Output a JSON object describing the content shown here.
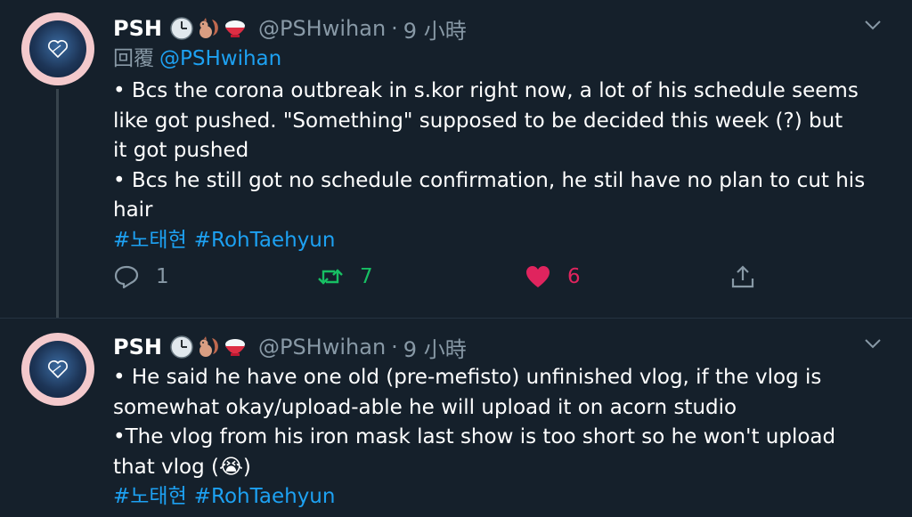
{
  "tweets": [
    {
      "name": "PSH",
      "emojis": [
        "clock-emoji",
        "squirrel-emoji",
        "rice-emoji"
      ],
      "handle": "@PSHwihan",
      "separator": "·",
      "time": "9 小時",
      "reply_prefix": "回覆",
      "reply_to": "@PSHwihan",
      "body": "• Bcs the corona outbreak in s.kor right now, a lot of his schedule seems\nlike got pushed. \"Something\" supposed to be decided this week (?) but\nit got pushed\n• Bcs he still got no schedule confirmation, he stil have no plan to cut his\nhair",
      "hashtags": [
        "#노태현",
        "#RohTaehyun"
      ],
      "replies": "1",
      "retweets": "7",
      "likes": "6"
    },
    {
      "name": "PSH",
      "emojis": [
        "clock-emoji",
        "squirrel-emoji",
        "rice-emoji"
      ],
      "handle": "@PSHwihan",
      "separator": "·",
      "time": "9 小時",
      "body": "• He said he have one old (pre-mefisto) unfinished vlog, if the vlog is\nsomewhat okay/upload-able he will upload it on acorn studio\n•The vlog from his iron mask last show is too short so he won't upload\nthat vlog (😭)",
      "hashtags": [
        "#노태현",
        "#RohTaehyun"
      ]
    }
  ],
  "colors": {
    "background": "#15202b",
    "secondary_text": "#8899a6",
    "link": "#1da1f2",
    "retweet_active": "#17bf63",
    "like_active": "#e0245e"
  }
}
